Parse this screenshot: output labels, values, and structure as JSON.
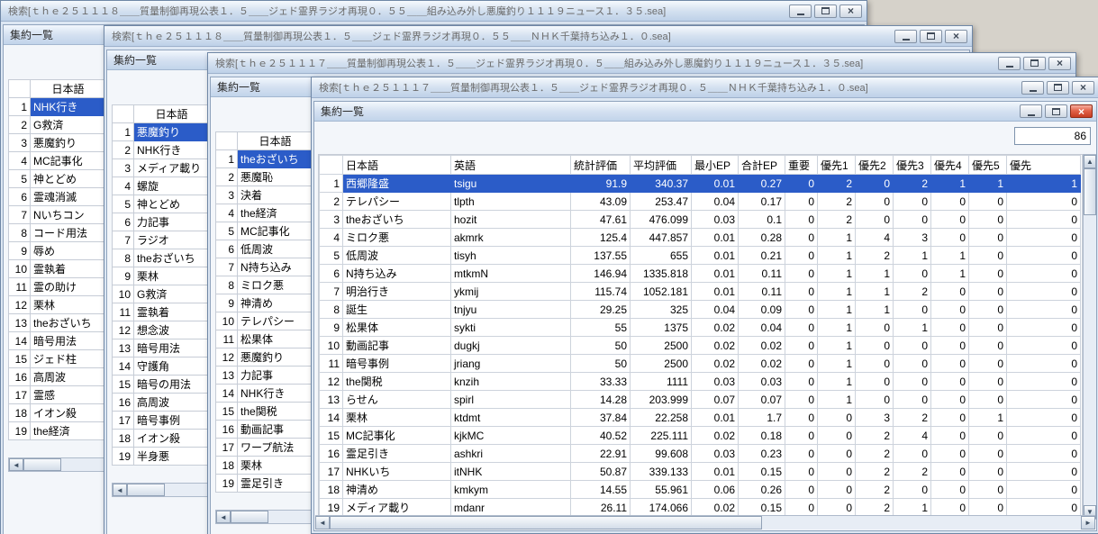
{
  "icons": {
    "close": "×",
    "scroll_up": "▲",
    "scroll_down": "▼",
    "scroll_left": "◄",
    "scroll_right": "►"
  },
  "colors": {
    "selection": "#2b5cc8",
    "titlebar": "#c7d8ec",
    "desktop": "#d6d2ca",
    "active_close": "#c63d22"
  },
  "windows": [
    {
      "title": "検索[ｔｈｅ２５１１１８＿＿質量制御再現公表１．５＿＿ジェド霊界ラジオ再現０．５５＿＿組み込み外し悪魔釣り１１１９ニュース１．３５.sea]",
      "child_title": "集約一覧",
      "list_header": "日本語",
      "selected_index": 0,
      "items": [
        "NHK行き",
        "G救済",
        "悪魔釣り",
        "MC記事化",
        "神とどめ",
        "霊魂消滅",
        "Nいちコン",
        "コード用法",
        "辱め",
        "霊執着",
        "霊の助け",
        "栗林",
        "theおざいち",
        "暗号用法",
        "ジェド柱",
        "高周波",
        "霊感",
        "イオン殺",
        "the経済"
      ]
    },
    {
      "title": "検索[ｔｈｅ２５１１１８＿＿質量制御再現公表１．５＿＿ジェド霊界ラジオ再現０．５５＿＿ＮＨＫ千葉持ち込み１．０.sea]",
      "child_title": "集約一覧",
      "list_header": "日本語",
      "selected_index": 0,
      "items": [
        "悪魔釣り",
        "NHK行き",
        "メディア載り",
        "螺旋",
        "神とどめ",
        "力記事",
        "ラジオ",
        "theおざいち",
        "栗林",
        "G救済",
        "霊執着",
        "想念波",
        "暗号用法",
        "守護角",
        "暗号の用法",
        "高周波",
        "暗号事例",
        "イオン殺",
        "半身悪"
      ]
    },
    {
      "title": "検索[ｔｈｅ２５１１１７＿＿質量制御再現公表１．５＿＿ジェド霊界ラジオ再現０．５＿＿組み込み外し悪魔釣り１１１９ニュース１．３５.sea]",
      "child_title": "集約一覧",
      "list_header": "日本語",
      "selected_index": 0,
      "items": [
        "theおざいち",
        "悪魔恥",
        "決着",
        "the経済",
        "MC記事化",
        "低周波",
        "N持ち込み",
        "ミロク悪",
        "神清め",
        "テレパシー",
        "松果体",
        "悪魔釣り",
        "力記事",
        "NHK行き",
        "the関税",
        "動画記事",
        "ワープ航法",
        "栗林",
        "霊足引き"
      ]
    },
    {
      "title": "検索[ｔｈｅ２５１１１７＿＿質量制御再現公表１．５＿＿ジェド霊界ラジオ再現０．５＿＿ＮＨＫ千葉持ち込み１．０.sea]",
      "child_title": "集約一覧",
      "count": "86",
      "table": {
        "columns": [
          "日本語",
          "英語",
          "統計評価",
          "平均評価",
          "最小EP",
          "合計EP",
          "重要",
          "優先1",
          "優先2",
          "優先3",
          "優先4",
          "優先5",
          "優先"
        ],
        "selected_row": 0,
        "rows": [
          [
            "西郷隆盛",
            "tsigu",
            "91.9",
            "340.37",
            "0.01",
            "0.27",
            "0",
            "2",
            "0",
            "2",
            "1",
            "1",
            "1"
          ],
          [
            "テレパシー",
            "tlpth",
            "43.09",
            "253.47",
            "0.04",
            "0.17",
            "0",
            "2",
            "0",
            "0",
            "0",
            "0",
            "0"
          ],
          [
            "theおざいち",
            "hozit",
            "47.61",
            "476.099",
            "0.03",
            "0.1",
            "0",
            "2",
            "0",
            "0",
            "0",
            "0",
            "0"
          ],
          [
            "ミロク悪",
            "akmrk",
            "125.4",
            "447.857",
            "0.01",
            "0.28",
            "0",
            "1",
            "4",
            "3",
            "0",
            "0",
            "0"
          ],
          [
            "低周波",
            "tisyh",
            "137.55",
            "655",
            "0.01",
            "0.21",
            "0",
            "1",
            "2",
            "1",
            "1",
            "0",
            "0"
          ],
          [
            "N持ち込み",
            "mtkmN",
            "146.94",
            "1335.818",
            "0.01",
            "0.11",
            "0",
            "1",
            "1",
            "0",
            "1",
            "0",
            "0"
          ],
          [
            "明治行き",
            "ykmij",
            "115.74",
            "1052.181",
            "0.01",
            "0.11",
            "0",
            "1",
            "1",
            "2",
            "0",
            "0",
            "0"
          ],
          [
            "誕生",
            "tnjyu",
            "29.25",
            "325",
            "0.04",
            "0.09",
            "0",
            "1",
            "1",
            "0",
            "0",
            "0",
            "0"
          ],
          [
            "松果体",
            "sykti",
            "55",
            "1375",
            "0.02",
            "0.04",
            "0",
            "1",
            "0",
            "1",
            "0",
            "0",
            "0"
          ],
          [
            "動画記事",
            "dugkj",
            "50",
            "2500",
            "0.02",
            "0.02",
            "0",
            "1",
            "0",
            "0",
            "0",
            "0",
            "0"
          ],
          [
            "暗号事例",
            "jriang",
            "50",
            "2500",
            "0.02",
            "0.02",
            "0",
            "1",
            "0",
            "0",
            "0",
            "0",
            "0"
          ],
          [
            "the関税",
            "knzih",
            "33.33",
            "1111",
            "0.03",
            "0.03",
            "0",
            "1",
            "0",
            "0",
            "0",
            "0",
            "0"
          ],
          [
            "らせん",
            "spirl",
            "14.28",
            "203.999",
            "0.07",
            "0.07",
            "0",
            "1",
            "0",
            "0",
            "0",
            "0",
            "0"
          ],
          [
            "栗林",
            "ktdmt",
            "37.84",
            "22.258",
            "0.01",
            "1.7",
            "0",
            "0",
            "3",
            "2",
            "0",
            "1",
            "0"
          ],
          [
            "MC記事化",
            "kjkMC",
            "40.52",
            "225.111",
            "0.02",
            "0.18",
            "0",
            "0",
            "2",
            "4",
            "0",
            "0",
            "0"
          ],
          [
            "霊足引き",
            "ashkri",
            "22.91",
            "99.608",
            "0.03",
            "0.23",
            "0",
            "0",
            "2",
            "0",
            "0",
            "0",
            "0"
          ],
          [
            "NHKいち",
            "itNHK",
            "50.87",
            "339.133",
            "0.01",
            "0.15",
            "0",
            "0",
            "2",
            "2",
            "0",
            "0",
            "0"
          ],
          [
            "神清め",
            "kmkym",
            "14.55",
            "55.961",
            "0.06",
            "0.26",
            "0",
            "0",
            "2",
            "0",
            "0",
            "0",
            "0"
          ],
          [
            "メディア載り",
            "mdanr",
            "26.11",
            "174.066",
            "0.02",
            "0.15",
            "0",
            "0",
            "2",
            "1",
            "0",
            "0",
            "0"
          ]
        ]
      }
    }
  ]
}
